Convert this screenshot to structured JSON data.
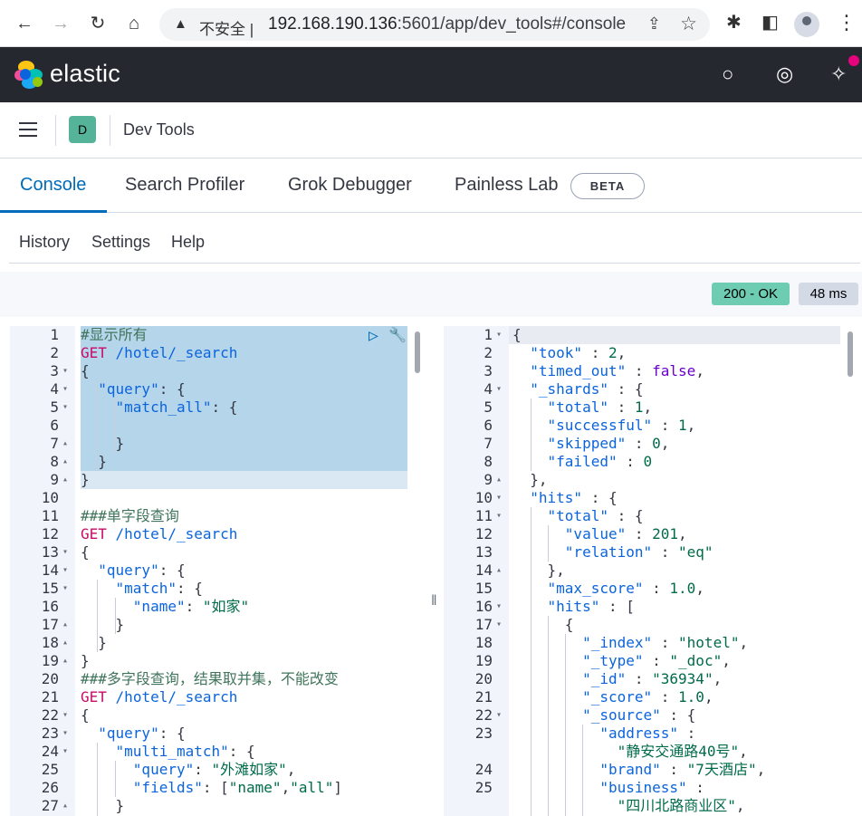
{
  "browser": {
    "back_icon": "←",
    "forward_icon": "→",
    "reload_icon": "↻",
    "home_icon": "⌂",
    "warning_icon": "▲",
    "insecure_label": "不安全 |",
    "url_host": "192.168.190.136",
    "url_rest": ":5601/app/dev_tools#/console",
    "share_icon": "⇪",
    "star_icon": "☆",
    "extensions_icon": "✱",
    "sidepanel_icon": "◧",
    "menu_icon": "⋮"
  },
  "kibana": {
    "brand": "elastic",
    "search_icon": "○",
    "help_icon": "◎",
    "news_icon": "✧"
  },
  "breadcrumb": {
    "space_initial": "D",
    "title": "Dev Tools"
  },
  "tabs": [
    {
      "label": "Console",
      "active": true
    },
    {
      "label": "Search Profiler",
      "active": false
    },
    {
      "label": "Grok Debugger",
      "active": false
    },
    {
      "label": "Painless Lab",
      "active": false
    }
  ],
  "beta_label": "BETA",
  "toolbar": {
    "history": "History",
    "settings": "Settings",
    "help": "Help"
  },
  "status": {
    "code": "200 - OK",
    "time": "48 ms"
  },
  "request_actions": {
    "run_icon": "▷",
    "wrench_icon": "🔧"
  },
  "divider_glyph": "‖",
  "request_lines": [
    {
      "n": "1",
      "f": "",
      "t": "#显示所有"
    },
    {
      "n": "2",
      "f": "",
      "t": "GET /hotel/_search"
    },
    {
      "n": "3",
      "f": "▾",
      "t": "{"
    },
    {
      "n": "4",
      "f": "▾",
      "t": "  \"query\": {"
    },
    {
      "n": "5",
      "f": "▾",
      "t": "    \"match_all\": {"
    },
    {
      "n": "6",
      "f": "",
      "t": "      "
    },
    {
      "n": "7",
      "f": "▴",
      "t": "    }"
    },
    {
      "n": "8",
      "f": "▴",
      "t": "  }"
    },
    {
      "n": "9",
      "f": "▴",
      "t": "}"
    },
    {
      "n": "10",
      "f": "",
      "t": ""
    },
    {
      "n": "11",
      "f": "",
      "t": "###单字段查询"
    },
    {
      "n": "12",
      "f": "",
      "t": "GET /hotel/_search"
    },
    {
      "n": "13",
      "f": "▾",
      "t": "{"
    },
    {
      "n": "14",
      "f": "▾",
      "t": "  \"query\": {"
    },
    {
      "n": "15",
      "f": "▾",
      "t": "    \"match\": {"
    },
    {
      "n": "16",
      "f": "",
      "t": "      \"name\": \"如家\""
    },
    {
      "n": "17",
      "f": "▴",
      "t": "    }"
    },
    {
      "n": "18",
      "f": "▴",
      "t": "  }"
    },
    {
      "n": "19",
      "f": "▴",
      "t": "}"
    },
    {
      "n": "20",
      "f": "",
      "t": "###多字段查询，结果取并集，不能改变"
    },
    {
      "n": "21",
      "f": "",
      "t": "GET /hotel/_search"
    },
    {
      "n": "22",
      "f": "▾",
      "t": "{"
    },
    {
      "n": "23",
      "f": "▾",
      "t": "  \"query\": {"
    },
    {
      "n": "24",
      "f": "▾",
      "t": "    \"multi_match\": {"
    },
    {
      "n": "25",
      "f": "",
      "t": "      \"query\": \"外滩如家\","
    },
    {
      "n": "26",
      "f": "",
      "t": "      \"fields\": [\"name\",\"all\"]"
    },
    {
      "n": "27",
      "f": "▴",
      "t": "    }"
    }
  ],
  "response_lines": [
    {
      "n": "1",
      "f": "▾",
      "t": "{"
    },
    {
      "n": "2",
      "f": "",
      "t": "  \"took\" : 2,"
    },
    {
      "n": "3",
      "f": "",
      "t": "  \"timed_out\" : false,"
    },
    {
      "n": "4",
      "f": "▾",
      "t": "  \"_shards\" : {"
    },
    {
      "n": "5",
      "f": "",
      "t": "    \"total\" : 1,"
    },
    {
      "n": "6",
      "f": "",
      "t": "    \"successful\" : 1,"
    },
    {
      "n": "7",
      "f": "",
      "t": "    \"skipped\" : 0,"
    },
    {
      "n": "8",
      "f": "",
      "t": "    \"failed\" : 0"
    },
    {
      "n": "9",
      "f": "▴",
      "t": "  },"
    },
    {
      "n": "10",
      "f": "▾",
      "t": "  \"hits\" : {"
    },
    {
      "n": "11",
      "f": "▾",
      "t": "    \"total\" : {"
    },
    {
      "n": "12",
      "f": "",
      "t": "      \"value\" : 201,"
    },
    {
      "n": "13",
      "f": "",
      "t": "      \"relation\" : \"eq\""
    },
    {
      "n": "14",
      "f": "▴",
      "t": "    },"
    },
    {
      "n": "15",
      "f": "",
      "t": "    \"max_score\" : 1.0,"
    },
    {
      "n": "16",
      "f": "▾",
      "t": "    \"hits\" : ["
    },
    {
      "n": "17",
      "f": "▾",
      "t": "      {"
    },
    {
      "n": "18",
      "f": "",
      "t": "        \"_index\" : \"hotel\","
    },
    {
      "n": "19",
      "f": "",
      "t": "        \"_type\" : \"_doc\","
    },
    {
      "n": "20",
      "f": "",
      "t": "        \"_id\" : \"36934\","
    },
    {
      "n": "21",
      "f": "",
      "t": "        \"_score\" : 1.0,"
    },
    {
      "n": "22",
      "f": "▾",
      "t": "        \"_source\" : {"
    },
    {
      "n": "23",
      "f": "",
      "t": "          \"address\" :"
    },
    {
      "n": "",
      "f": "",
      "t": "            \"静安交通路40号\","
    },
    {
      "n": "24",
      "f": "",
      "t": "          \"brand\" : \"7天酒店\","
    },
    {
      "n": "25",
      "f": "",
      "t": "          \"business\" :"
    },
    {
      "n": "",
      "f": "",
      "t": "            \"四川北路商业区\","
    }
  ],
  "colors": {
    "nav_bg": "#25282f",
    "accent": "#006bb8",
    "ok_badge": "#6dccb1",
    "selection": "#b5d5ea"
  }
}
